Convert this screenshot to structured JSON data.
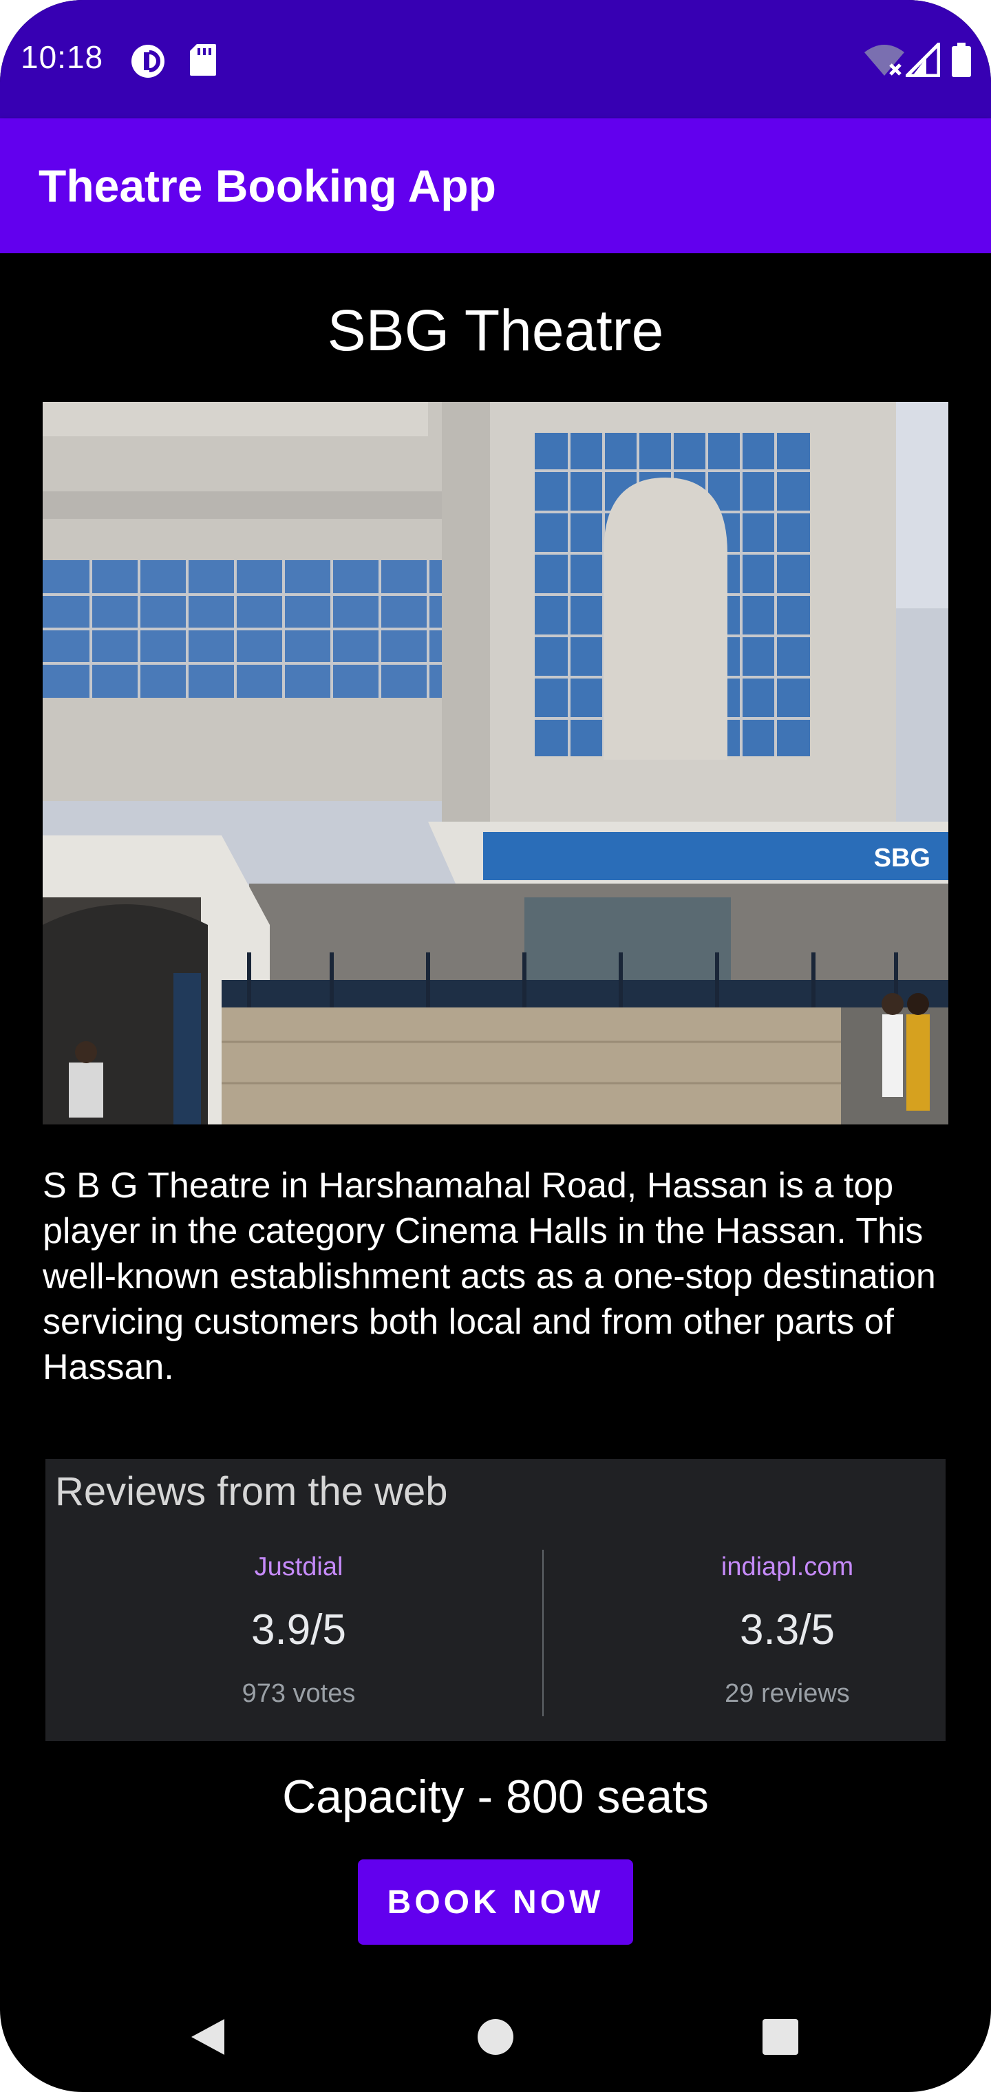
{
  "status_bar": {
    "time": "10:18",
    "icons": [
      "data-saver-icon",
      "sd-card-icon",
      "wifi-off-icon",
      "signal-icon",
      "battery-icon"
    ]
  },
  "app_bar": {
    "title": "Theatre Booking App",
    "color": "#6200ee"
  },
  "theatre": {
    "name": "SBG Theatre",
    "photo_sign_text": "SBG",
    "description": "S B G Theatre in Harshamahal Road, Hassan is a top player in the category Cinema Halls in the Hassan. This well-known establishment acts as a one-stop destination servicing customers both local and from other parts of Hassan.",
    "capacity": "Capacity - 800 seats"
  },
  "reviews": {
    "title": "Reviews from the web",
    "sources": [
      {
        "name": "Justdial",
        "score": "3.9/5",
        "count": "973 votes"
      },
      {
        "name": "indiapl.com",
        "score": "3.3/5",
        "count": "29 reviews"
      }
    ]
  },
  "actions": {
    "book_label": "BOOK NOW"
  },
  "nav": {
    "icons": [
      "back-icon",
      "home-icon",
      "recents-icon"
    ]
  }
}
